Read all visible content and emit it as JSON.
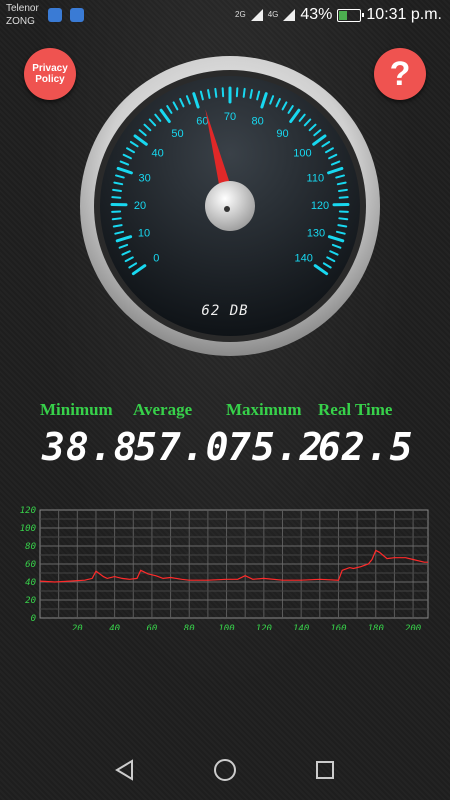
{
  "status_bar": {
    "carrier1": "Telenor",
    "carrier2": "ZONG",
    "network1": "2G",
    "network2": "4G",
    "battery_percent": "43%",
    "battery_level": 0.43,
    "time": "10:31 p.m."
  },
  "buttons": {
    "privacy_label_line1": "Privacy",
    "privacy_label_line2": "Policy",
    "help_label": "?"
  },
  "gauge": {
    "readout": "62 DB",
    "value": 62,
    "min": 0,
    "max": 140,
    "tick_labels": [
      "0",
      "10",
      "20",
      "30",
      "40",
      "50",
      "60",
      "70",
      "80",
      "90",
      "100",
      "110",
      "120",
      "130",
      "140"
    ],
    "accent": "#18d8f0",
    "needle_color": "#e02828"
  },
  "stats": {
    "min_label": "Minimum",
    "avg_label": "Average",
    "max_label": "Maximum",
    "rt_label": "Real Time",
    "min_value": "38.8",
    "avg_value": "57.0",
    "max_value": "75.2",
    "rt_value": "62.5",
    "label_color": "#37d14a"
  },
  "chart_data": {
    "type": "line",
    "x_ticks": [
      "20",
      "40",
      "60",
      "80",
      "100",
      "120",
      "140",
      "160",
      "180",
      "200"
    ],
    "y_ticks": [
      "0",
      "20",
      "40",
      "60",
      "80",
      "100",
      "120"
    ],
    "xlim": [
      0,
      208
    ],
    "ylim": [
      0,
      120
    ],
    "grid": true,
    "line_color": "#ff2a2a",
    "tick_color": "#37d14a",
    "series": [
      {
        "x": [
          0,
          8,
          16,
          24,
          28,
          30,
          34,
          36,
          40,
          44,
          48,
          52,
          54,
          58,
          62,
          66,
          70,
          76,
          80,
          90,
          100,
          106,
          110,
          114,
          120,
          130,
          140,
          150,
          160,
          162,
          166,
          168,
          172,
          176,
          178,
          180,
          182,
          186,
          190,
          196,
          200,
          206,
          208
        ],
        "y": [
          41,
          40,
          41,
          42,
          44,
          52,
          46,
          44,
          46,
          44,
          43,
          44,
          53,
          49,
          47,
          44,
          45,
          43,
          42,
          42,
          43,
          43,
          47,
          43,
          44,
          42,
          42,
          43,
          42,
          53,
          56,
          55,
          57,
          60,
          65,
          75,
          73,
          66,
          67,
          67,
          65,
          62,
          62
        ]
      }
    ]
  },
  "nav": {
    "back_icon": "back-icon",
    "home_icon": "home-icon",
    "recents_icon": "recents-icon"
  }
}
